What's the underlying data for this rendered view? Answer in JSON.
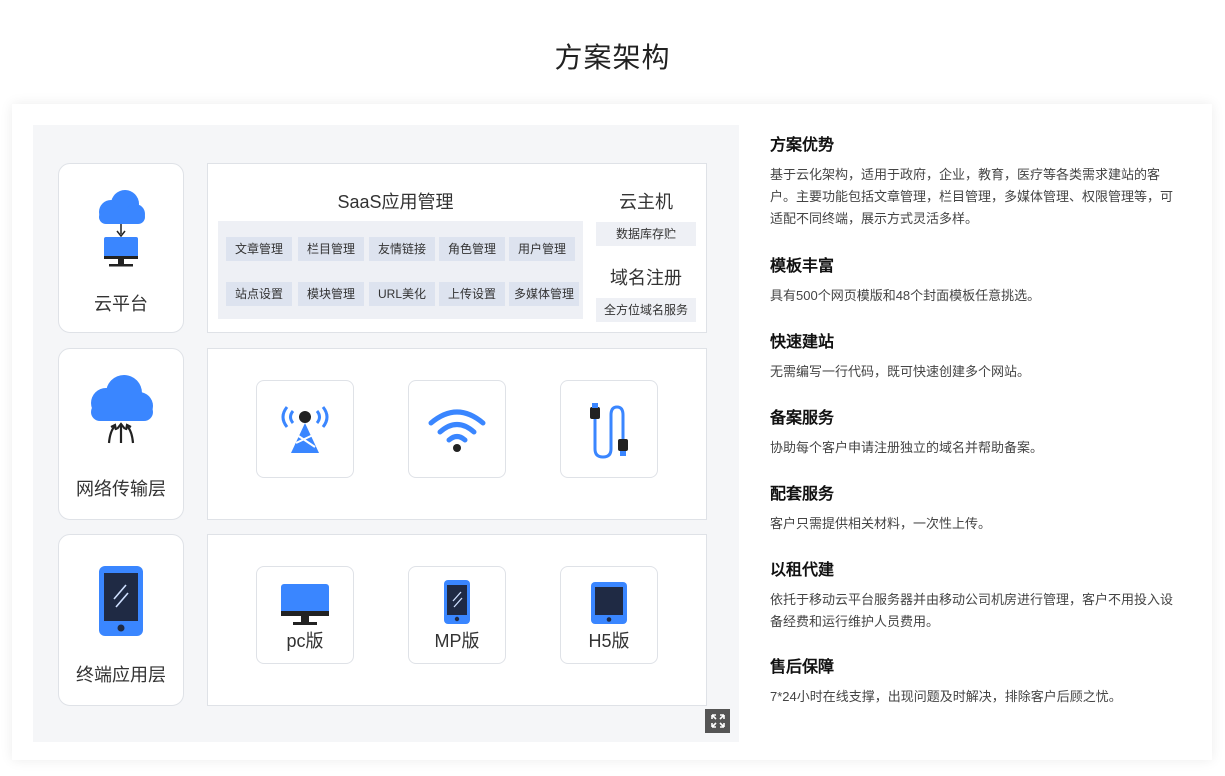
{
  "page": {
    "title": "方案架构"
  },
  "diagram": {
    "layers": [
      {
        "label": "云平台",
        "icon": "cloud-server-icon"
      },
      {
        "label": "网络传输层",
        "icon": "cloud-upload-icon"
      },
      {
        "label": "终端应用层",
        "icon": "phone-icon"
      }
    ],
    "saas": {
      "title": "SaaS应用管理",
      "row1": [
        "文章管理",
        "栏目管理",
        "友情链接",
        "角色管理",
        "用户管理"
      ],
      "row2": [
        "站点设置",
        "模块管理",
        "URL美化",
        "上传设置",
        "多媒体管理"
      ]
    },
    "cloud_host": {
      "title": "云主机",
      "tag": "数据库存贮"
    },
    "domain_reg": {
      "title": "域名注册",
      "tag": "全方位域名服务"
    },
    "network_tiles": [
      {
        "icon": "signal-tower-icon"
      },
      {
        "icon": "wifi-icon"
      },
      {
        "icon": "cable-icon"
      }
    ],
    "terminal_tiles": [
      {
        "icon": "monitor-icon",
        "label": "pc版"
      },
      {
        "icon": "phone-icon",
        "label": "MP版"
      },
      {
        "icon": "tablet-icon",
        "label": "H5版"
      }
    ],
    "accent": "#3a86ff"
  },
  "advantages": [
    {
      "title": "方案优势",
      "desc": "基于云化架构，适用于政府，企业，教育，医疗等各类需求建站的客户。主要功能包括文章管理，栏目管理，多媒体管理、权限管理等，可适配不同终端，展示方式灵活多样。"
    },
    {
      "title": "模板丰富",
      "desc": "具有500个网页模版和48个封面模板任意挑选。"
    },
    {
      "title": "快速建站",
      "desc": "无需编写一行代码，既可快速创建多个网站。"
    },
    {
      "title": "备案服务",
      "desc": "协助每个客户申请注册独立的域名并帮助备案。"
    },
    {
      "title": "配套服务",
      "desc": "客户只需提供相关材料，一次性上传。"
    },
    {
      "title": "以租代建",
      "desc": "依托于移动云平台服务器并由移动公司机房进行管理，客户不用投入设备经费和运行维护人员费用。"
    },
    {
      "title": "售后保障",
      "desc": "7*24小时在线支撑，出现问题及时解决，排除客户后顾之忧。"
    }
  ]
}
